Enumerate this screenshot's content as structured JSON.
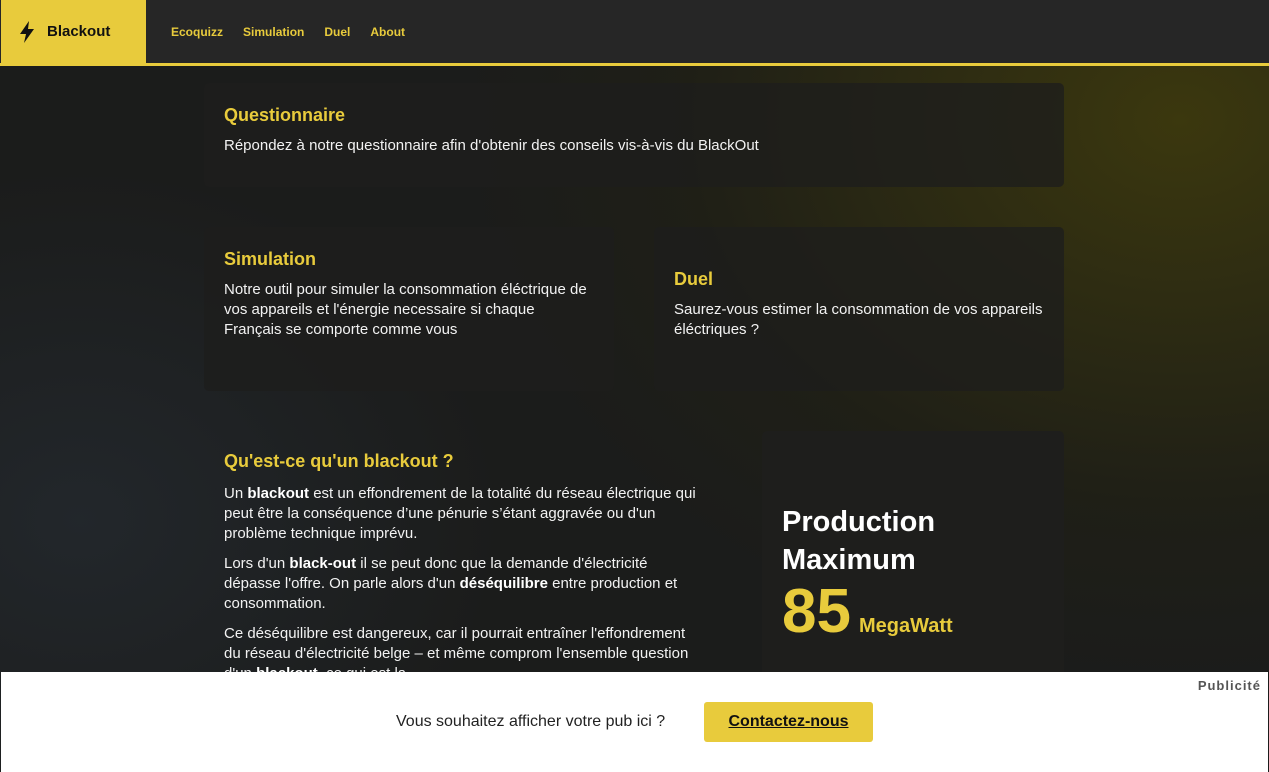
{
  "navbar": {
    "brand": "Blackout",
    "links": [
      "Ecoquizz",
      "Simulation",
      "Duel",
      "About"
    ]
  },
  "cards": {
    "questionnaire": {
      "title": "Questionnaire",
      "text": "Répondez à notre questionnaire afin d'obtenir des conseils vis-à-vis du BlackOut"
    },
    "simulation": {
      "title": "Simulation",
      "text": "Notre outil pour simuler la consommation éléctrique de vos appareils et l'énergie necessaire si chaque Français se comporte comme vous"
    },
    "duel": {
      "title": "Duel",
      "text": "Saurez-vous estimer la consommation de vos appareils éléctriques ?"
    }
  },
  "info": {
    "title": "Qu'est-ce qu'un blackout ?",
    "p1": {
      "a": "Un ",
      "b": "blackout",
      "c": " est un effondrement de la totalité du réseau électrique qui peut être la conséquence d’une pénurie s’étant aggravée ou d'un problème technique imprévu."
    },
    "p2": {
      "a": "Lors d'un ",
      "b": "black-out",
      "c": " il se peut donc que la demande d'électricité dépasse l'offre. On parle alors d'un ",
      "d": "déséquilibre",
      "e": " entre production et consommation."
    },
    "p3": {
      "a": "Ce déséquilibre est dangereux, car il pourrait entraîner l'effondrement du réseau d'électricité belge – et même comprom l'ensemble question d'un ",
      "b": "blackout",
      "c": ", ce qui est la"
    }
  },
  "production": {
    "title": "Production Maximum",
    "value": "85",
    "unit": "MegaWatt"
  },
  "ad": {
    "label": "Publicité",
    "text": "Vous souhaitez afficher votre pub ici ?",
    "button": "Contactez-nous"
  },
  "colors": {
    "accent": "#e8cb3c",
    "navbar": "#262626",
    "card": "#1e1e1c"
  }
}
